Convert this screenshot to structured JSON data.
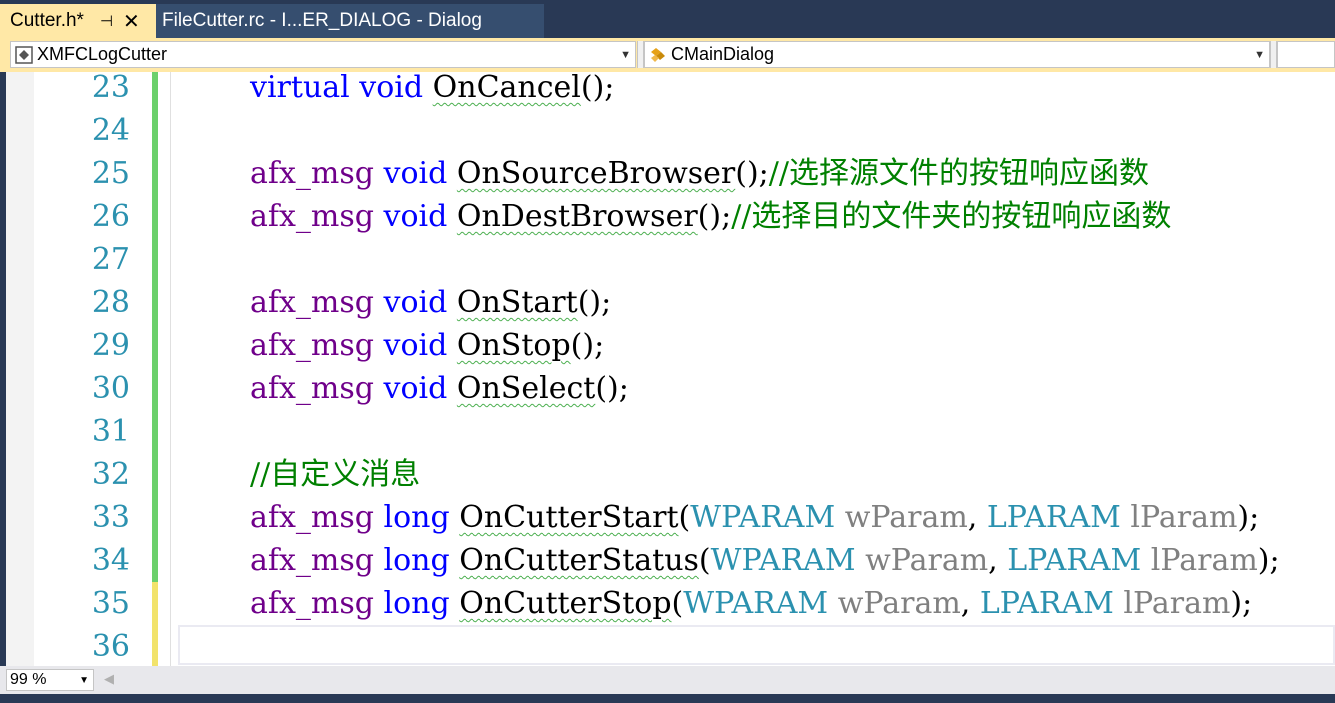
{
  "tabs": [
    {
      "label": "Cutter.h*",
      "active": true,
      "pin_icon": "pin-icon",
      "close_icon": "close-icon"
    },
    {
      "label": "FileCutter.rc - I...ER_DIALOG - Dialog",
      "active": false
    }
  ],
  "navbar": {
    "project_combo": "XMFCLogCutter",
    "class_combo": "CMainDialog"
  },
  "editor": {
    "lines": [
      {
        "num": "23"
      },
      {
        "num": "24"
      },
      {
        "num": "25"
      },
      {
        "num": "26"
      },
      {
        "num": "27"
      },
      {
        "num": "28"
      },
      {
        "num": "29"
      },
      {
        "num": "30"
      },
      {
        "num": "31"
      },
      {
        "num": "32"
      },
      {
        "num": "33"
      },
      {
        "num": "34"
      },
      {
        "num": "35"
      },
      {
        "num": "36"
      }
    ],
    "tokens": {
      "virtual": "virtual",
      "void": "void",
      "afx_msg": "afx_msg",
      "long": "long",
      "WPARAM": "WPARAM",
      "LPARAM": "LPARAM",
      "wParam": "wParam",
      "lParam": "lParam",
      "OnCancel": "OnCancel",
      "OnSourceBrowser": "OnSourceBrowser",
      "OnDestBrowser": "OnDestBrowser",
      "OnStart": "OnStart",
      "OnStop": "OnStop",
      "OnSelect": "OnSelect",
      "OnCutterStart": "OnCutterStart",
      "OnCutterStatus": "OnCutterStatus",
      "OnCutterStop": "OnCutterStop",
      "comment_25": "//选择源文件的按钮响应函数",
      "comment_26": "//选择目的文件夹的按钮响应函数",
      "comment_32": "//自定义消息"
    }
  },
  "status": {
    "zoom": "99 %"
  },
  "colors": {
    "tab_active_bg": "#ffe8a6",
    "chrome_bg": "#293955",
    "line_number": "#2b91af",
    "macro": "#6f008a",
    "keyword": "#0000ff",
    "type": "#2b91af",
    "comment": "#008000",
    "saved_change": "#6bd06b",
    "unsaved_change": "#f2e36b"
  }
}
